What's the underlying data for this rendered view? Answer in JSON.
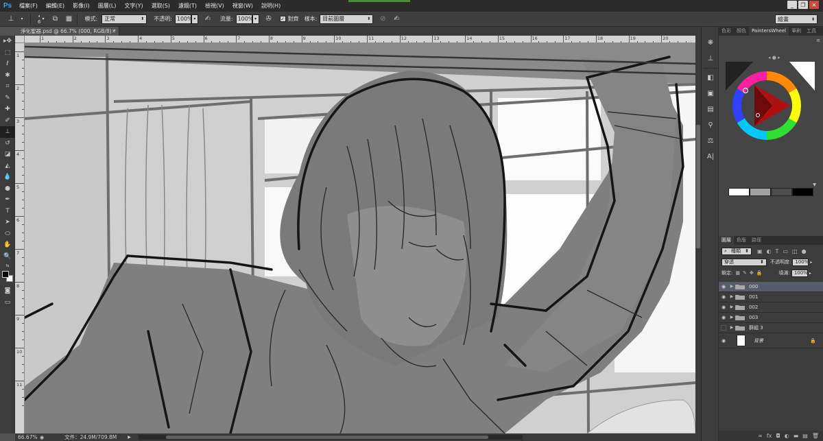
{
  "app": {
    "logo": "Ps"
  },
  "menu": [
    "檔案(F)",
    "編輯(E)",
    "影像(I)",
    "圖層(L)",
    "文字(Y)",
    "選取(S)",
    "濾鏡(T)",
    "檢視(V)",
    "視窗(W)",
    "說明(H)"
  ],
  "window_controls": [
    "_",
    "❐",
    "✕"
  ],
  "options": {
    "brush_size": "6",
    "mode_label": "模式:",
    "mode_value": "正常",
    "opacity_label": "不透明:",
    "opacity_value": "100%",
    "flow_label": "流量:",
    "flow_value": "100%",
    "aligned_label": "對齊",
    "sample_label": "樣本:",
    "sample_value": "目前圖層",
    "workspace_value": "繪畫"
  },
  "document": {
    "tab_title": "淨化聖器.psd @ 66.7% (000, RGB/8) *",
    "close": "×"
  },
  "ruler": {
    "top_ticks": [
      "1",
      "2",
      "3",
      "4",
      "5",
      "6",
      "7",
      "8",
      "9",
      "10",
      "11",
      "12",
      "13",
      "14",
      "15",
      "16",
      "17",
      "18",
      "19",
      "20"
    ],
    "left_ticks": [
      "1",
      "2",
      "3",
      "4",
      "5",
      "6",
      "7",
      "8",
      "9",
      "10",
      "11"
    ]
  },
  "status": {
    "zoom": "66.67%",
    "doc_size": "文件：24.9M/709.8M",
    "arrow": "▶"
  },
  "color_panel": {
    "tabs": [
      "色彩",
      "顏色",
      "PaintersWheel",
      "筆刷",
      "工具"
    ],
    "active_tab": "PaintersWheel",
    "swatches": [
      "#ffffff",
      "#a0a0a0",
      "#4c4c4c",
      "#000000"
    ]
  },
  "layers_panel": {
    "tabs": [
      "圖層",
      "色版",
      "路徑"
    ],
    "active_tab": "圖層",
    "filter_label": "種類",
    "blend_mode": "穿透",
    "opacity_label": "不透明度:",
    "opacity_value": "100%",
    "lock_label": "鎖定:",
    "fill_label": "填滿:",
    "fill_value": "100%",
    "layers": [
      {
        "name": "000",
        "visible": true,
        "selected": true
      },
      {
        "name": "001",
        "visible": true,
        "selected": false
      },
      {
        "name": "002",
        "visible": true,
        "selected": false
      },
      {
        "name": "003",
        "visible": true,
        "selected": false
      },
      {
        "name": "群組 3",
        "visible": false,
        "selected": false
      },
      {
        "name": "背景",
        "visible": true,
        "selected": false
      }
    ],
    "bottom_icons": [
      "∞",
      "fx",
      "◘",
      "◐",
      "▬",
      "▤",
      "🗑"
    ]
  },
  "colors": {
    "accent": "#31a8ff",
    "canvas_gray": "#7d7d7d",
    "panel": "#3c3c3c"
  }
}
